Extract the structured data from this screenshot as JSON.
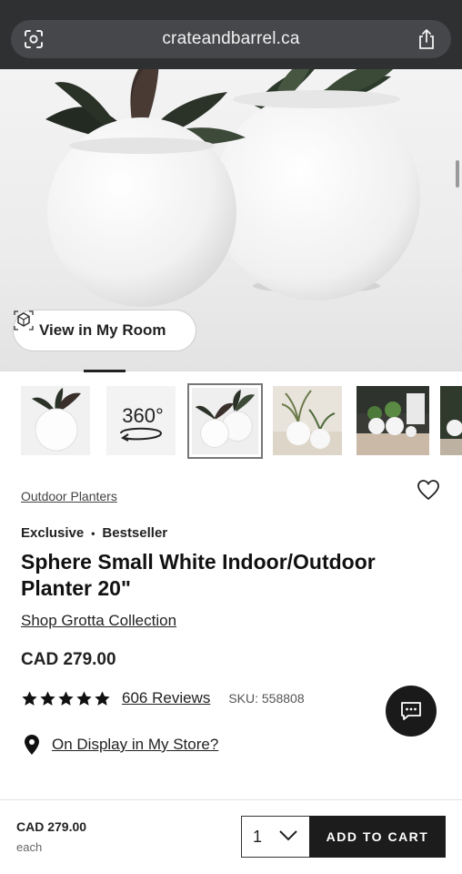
{
  "browser": {
    "url": "crateandbarrel.ca",
    "lens_icon": "visual-search-icon",
    "share_icon": "share-icon"
  },
  "hero": {
    "view_in_room_label": "View in My Room",
    "ar_icon": "ar-cube-icon",
    "image_index": 1
  },
  "thumbnails": {
    "items": [
      {
        "name": "thumb-planter-single"
      },
      {
        "name": "thumb-360",
        "label": "360°"
      },
      {
        "name": "thumb-planter-pair",
        "selected": true
      },
      {
        "name": "thumb-planters-outdoor"
      },
      {
        "name": "thumb-patio-scene"
      },
      {
        "name": "thumb-partial"
      }
    ]
  },
  "product": {
    "category": "Outdoor Planters",
    "tags": [
      "Exclusive",
      "Bestseller"
    ],
    "tag_separator": "•",
    "title": "Sphere Small White Indoor/Outdoor Planter 20\"",
    "collection_link": "Shop Grotta Collection",
    "price": "CAD 279.00",
    "rating": 5,
    "reviews_label": "606 Reviews",
    "sku_label": "SKU: 558808",
    "store_link": "On Display in My Store?",
    "heart_icon": "wishlist-heart-icon",
    "pin_icon": "location-pin-icon"
  },
  "chat": {
    "icon": "chat-bubble-icon"
  },
  "sticky": {
    "price": "CAD 279.00",
    "unit": "each",
    "quantity": "1",
    "add_to_cart": "ADD TO CART"
  }
}
